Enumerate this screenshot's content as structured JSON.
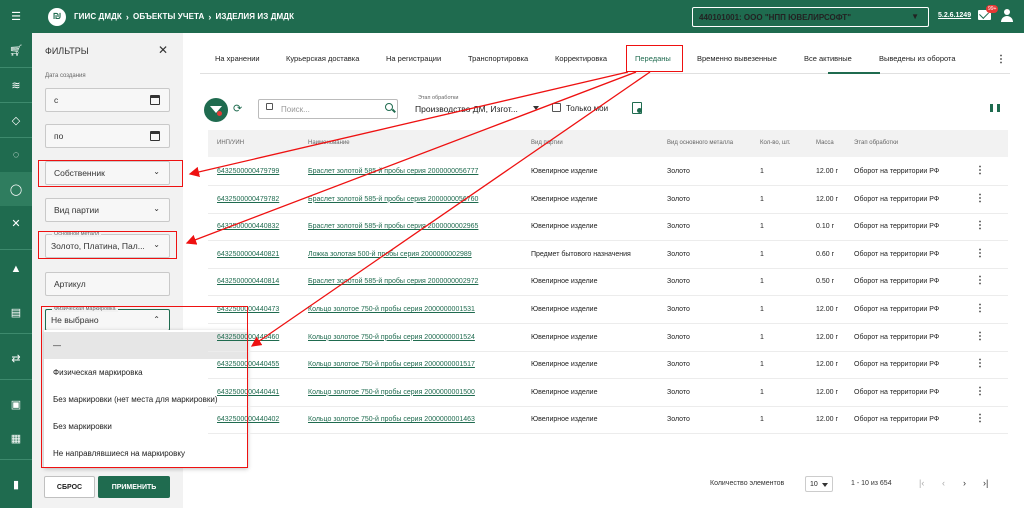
{
  "topbar": {
    "logo_letter": "₪",
    "breadcrumb": [
      "ГИИС ДМДК",
      "ОБЪЕКТЫ УЧЕТА",
      "ИЗДЕЛИЯ ИЗ ДМДК"
    ],
    "organization": "440101001: ООО \"НПП ЮВЕЛИРСОФТ\"",
    "version": "5.2.6.1249",
    "notifications_badge": "99+"
  },
  "rail": {
    "icons": [
      "menu-icon",
      "cart-icon",
      "layers-icon",
      "gem-icon",
      "circle-dashed-icon",
      "ring-icon",
      "tools-icon",
      "flask-icon",
      "clipboard-icon",
      "sync-icon",
      "id-card-icon",
      "list-card-icon",
      "document-icon"
    ]
  },
  "filters": {
    "title": "ФИЛЬТРЫ",
    "date_label": "Дата создания",
    "date_from": "с",
    "date_to": "по",
    "owner": "Собственник",
    "batch_type": "Вид партии",
    "metal_label": "Основной металл",
    "metal_value": "Золото, Платина, Пал...",
    "article": "Артикул",
    "marking_label": "Физическая маркировка",
    "marking_value": "Не выбрано",
    "reset": "СБРОС",
    "apply": "ПРИМЕНИТЬ"
  },
  "marking_dropdown": {
    "options": [
      "—",
      "Физическая маркировка",
      "Без маркировки (нет места для маркировки)",
      "Без маркировки",
      "Не направлявшиеся на маркировку"
    ]
  },
  "tabs": [
    "На хранении",
    "Курьерская доставка",
    "На регистрации",
    "Транспортировка",
    "Корректировка",
    "Переданы",
    "Временно вывезенные",
    "Все активные",
    "Выведены из оборота"
  ],
  "active_tab": "Переданы",
  "toolbar": {
    "search_placeholder": "Поиск...",
    "stage_label": "Этап обработки",
    "stage_value": "Производство ДМ, Изгот...",
    "only_mine": "Только мои"
  },
  "table": {
    "headers": [
      "ИНП/УИН",
      "Наименование",
      "Вид партии",
      "Вид основного металла",
      "Кол-во, шт.",
      "Масса",
      "Этап обработки"
    ],
    "rows": [
      [
        "6432500000479799",
        "Браслет золотой 585-й пробы серия 2000000056777",
        "Ювелирное изделие",
        "Золото",
        "1",
        "12.00 г",
        "Оборот на территории РФ"
      ],
      [
        "6432500000479782",
        "Браслет золотой 585-й пробы серия 2000000056760",
        "Ювелирное изделие",
        "Золото",
        "1",
        "12.00 г",
        "Оборот на территории РФ"
      ],
      [
        "6432500000440832",
        "Браслет золотой 585-й пробы серия 2000000002965",
        "Ювелирное изделие",
        "Золото",
        "1",
        "0.10 г",
        "Оборот на территории РФ"
      ],
      [
        "6432500000440821",
        "Ложка золотая 500-й пробы серия 2000000002989",
        "Предмет бытового назначения",
        "Золото",
        "1",
        "0.60 г",
        "Оборот на территории РФ"
      ],
      [
        "6432500000440814",
        "Браслет золотой 585-й пробы серия 2000000002972",
        "Ювелирное изделие",
        "Золото",
        "1",
        "0.50 г",
        "Оборот на территории РФ"
      ],
      [
        "6432500000440473",
        "Кольцо золотое 750-й пробы серия 2000000001531",
        "Ювелирное изделие",
        "Золото",
        "1",
        "12.00 г",
        "Оборот на территории РФ"
      ],
      [
        "6432500000440460",
        "Кольцо золотое 750-й пробы серия 2000000001524",
        "Ювелирное изделие",
        "Золото",
        "1",
        "12.00 г",
        "Оборот на территории РФ"
      ],
      [
        "6432500000440455",
        "Кольцо золотое 750-й пробы серия 2000000001517",
        "Ювелирное изделие",
        "Золото",
        "1",
        "12.00 г",
        "Оборот на территории РФ"
      ],
      [
        "6432500000440441",
        "Кольцо золотое 750-й пробы серия 2000000001500",
        "Ювелирное изделие",
        "Золото",
        "1",
        "12.00 г",
        "Оборот на территории РФ"
      ],
      [
        "6432500000440402",
        "Кольцо золотое 750-й пробы серия 2000000001463",
        "Ювелирное изделие",
        "Золото",
        "1",
        "12.00 г",
        "Оборот на территории РФ"
      ]
    ]
  },
  "pagination": {
    "label": "Количество элементов",
    "page_size": "10",
    "range": "1 - 10 из 654"
  },
  "colors": {
    "brand": "#1f6b4f",
    "annotation": "#e11111"
  }
}
